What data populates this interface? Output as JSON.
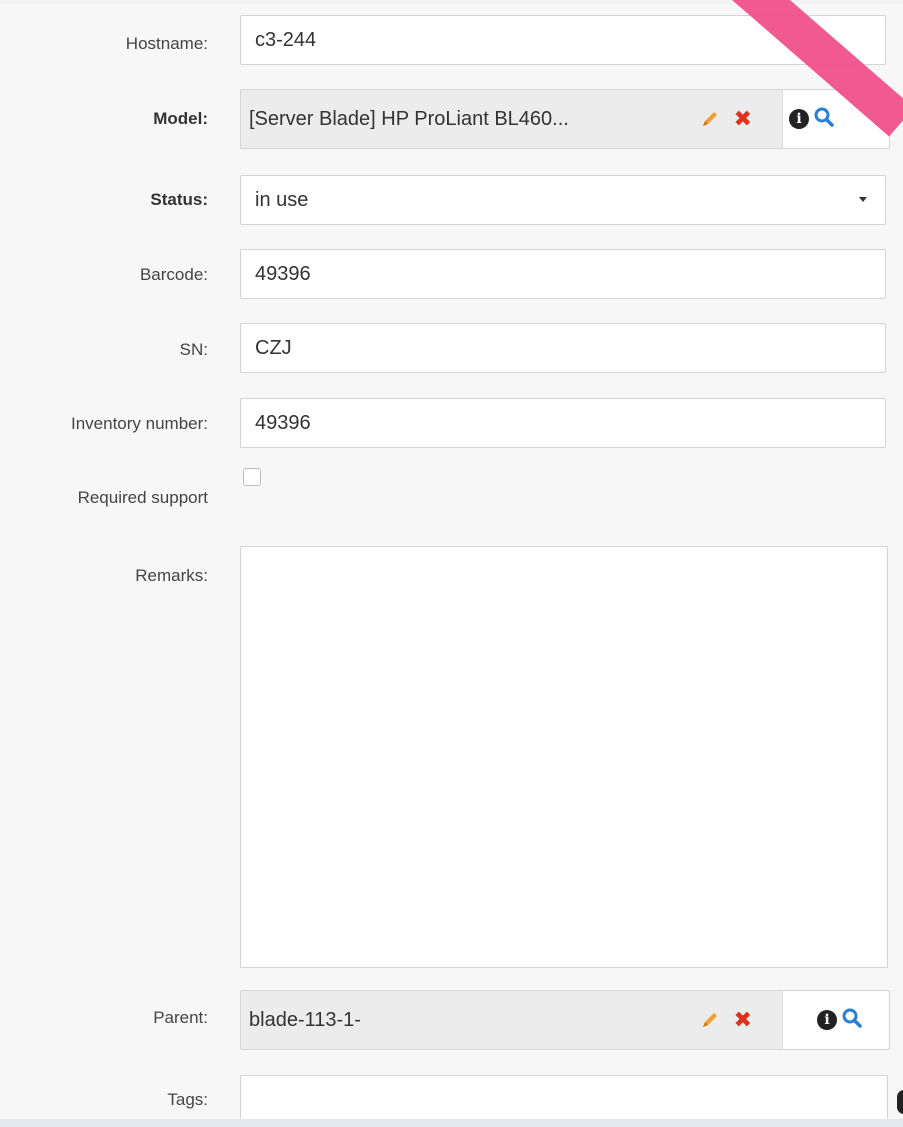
{
  "fields": {
    "hostname": {
      "label": "Hostname:",
      "value": "c3-244"
    },
    "model": {
      "label": "Model:",
      "value": "[Server Blade] HP ProLiant BL460..."
    },
    "status": {
      "label": "Status:",
      "value": "in use"
    },
    "barcode": {
      "label": "Barcode:",
      "value": "49396"
    },
    "sn": {
      "label": "SN:",
      "value": "CZJ"
    },
    "inventory_number": {
      "label": "Inventory number:",
      "value": "49396"
    },
    "required_support": {
      "label": "Required support",
      "checked": false
    },
    "remarks": {
      "label": "Remarks:",
      "value": ""
    },
    "parent": {
      "label": "Parent:",
      "value": "blade-113-1-"
    },
    "tags": {
      "label": "Tags:",
      "value": ""
    }
  },
  "icons": {
    "edit": "pencil-icon",
    "clear": "close-icon",
    "info": "info-icon",
    "search": "search-icon",
    "dropdown": "caret-down-icon"
  },
  "colors": {
    "pencil": "#f0a030",
    "clear": "#e0301e",
    "search": "#2a7fd4",
    "annotation_stroke": "#f0508b"
  }
}
